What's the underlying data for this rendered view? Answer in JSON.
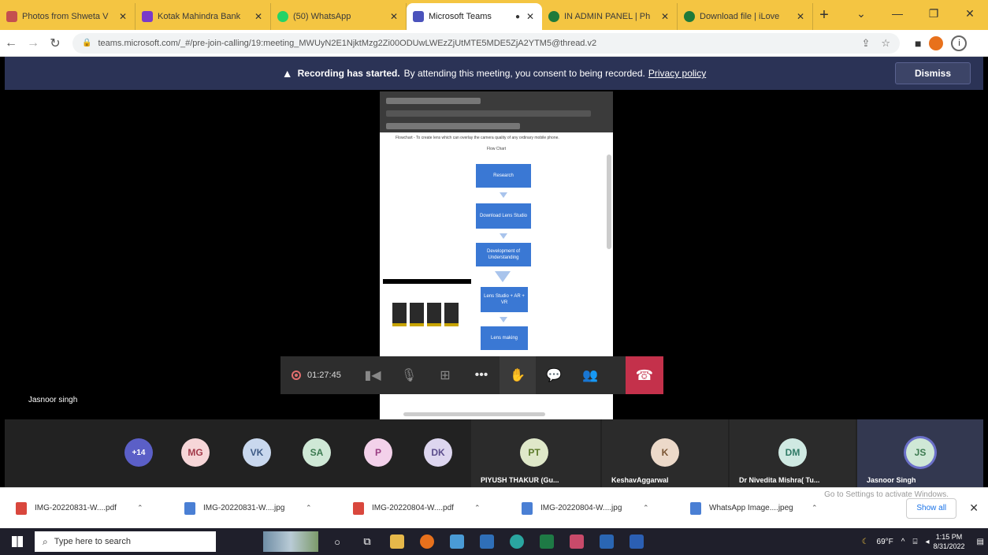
{
  "tabs": [
    {
      "title": "Photos from Shweta V",
      "color": "#c44f4f"
    },
    {
      "title": "Kotak Mahindra Bank",
      "color": "#7a3ac8"
    },
    {
      "title": "(50) WhatsApp",
      "color": "#25d366"
    },
    {
      "title": "Microsoft Teams",
      "color": "#4b53bc",
      "active": true
    },
    {
      "title": "IN ADMIN PANEL | Ph",
      "color": "#1f7a3a"
    },
    {
      "title": "Download file | iLove",
      "color": "#1f7a3a"
    }
  ],
  "address": {
    "url": "teams.microsoft.com/_#/pre-join-calling/19:meeting_MWUyN2E1NjktMzg2Zi00ODUwLWEzZjUtMTE5MDE5ZjA2YTM5@thread.v2"
  },
  "banner": {
    "bold": "Recording has started.",
    "text": "By attending this meeting, you consent to being recorded.",
    "link": "Privacy policy",
    "dismiss": "Dismiss"
  },
  "stage": {
    "presenter_name": "Jasnoor singh",
    "flowchart": {
      "title": "Flow Chart",
      "heading_text": "Flowchart - To create lens which can overlay the camera quality of any ordinary mobile phone.",
      "steps": [
        "Research",
        "Download Lens Studio",
        "Development of Understanding",
        "Lens Studio + AR + VR",
        "Lens making"
      ]
    }
  },
  "controls": {
    "timer": "01:27:45"
  },
  "participants": {
    "overflow": "+14",
    "avatars": [
      {
        "initials": "MG",
        "bg": "#f6d6d8",
        "fg": "#a33a4a"
      },
      {
        "initials": "VK",
        "bg": "#c9d8ee",
        "fg": "#3e5b86"
      },
      {
        "initials": "SA",
        "bg": "#cfe8d6",
        "fg": "#3c7a50"
      },
      {
        "initials": "P",
        "bg": "#f3d1ea",
        "fg": "#9a3d83"
      },
      {
        "initials": "DK",
        "bg": "#ddd6ef",
        "fg": "#5b4d8c"
      }
    ],
    "tiles": [
      {
        "initials": "PT",
        "name": "PIYUSH THAKUR (Gu...",
        "bg": "#dfe8c9",
        "fg": "#5b7a2a"
      },
      {
        "initials": "K",
        "name": "KeshavAggarwal",
        "bg": "#ecd9c9",
        "fg": "#7a5533"
      },
      {
        "initials": "DM",
        "name": "Dr Nivedita Mishra( Tu...",
        "bg": "#cfe9e2",
        "fg": "#2f7a66"
      },
      {
        "initials": "JS",
        "name": "Jasnoor Singh",
        "bg": "#cfe8d6",
        "fg": "#3c7a50"
      }
    ]
  },
  "downloads": {
    "items": [
      {
        "name": "IMG-20220831-W....pdf",
        "type": "pdf"
      },
      {
        "name": "IMG-20220831-W....jpg",
        "type": "img"
      },
      {
        "name": "IMG-20220804-W....pdf",
        "type": "pdf"
      },
      {
        "name": "IMG-20220804-W....jpg",
        "type": "img"
      },
      {
        "name": "WhatsApp Image....jpeg",
        "type": "img"
      }
    ],
    "show_all": "Show all",
    "watermark": "Go to Settings to activate Windows."
  },
  "taskbar": {
    "search_placeholder": "Type here to search",
    "weather": "69°F",
    "time": "1:15 PM",
    "date": "8/31/2022"
  }
}
